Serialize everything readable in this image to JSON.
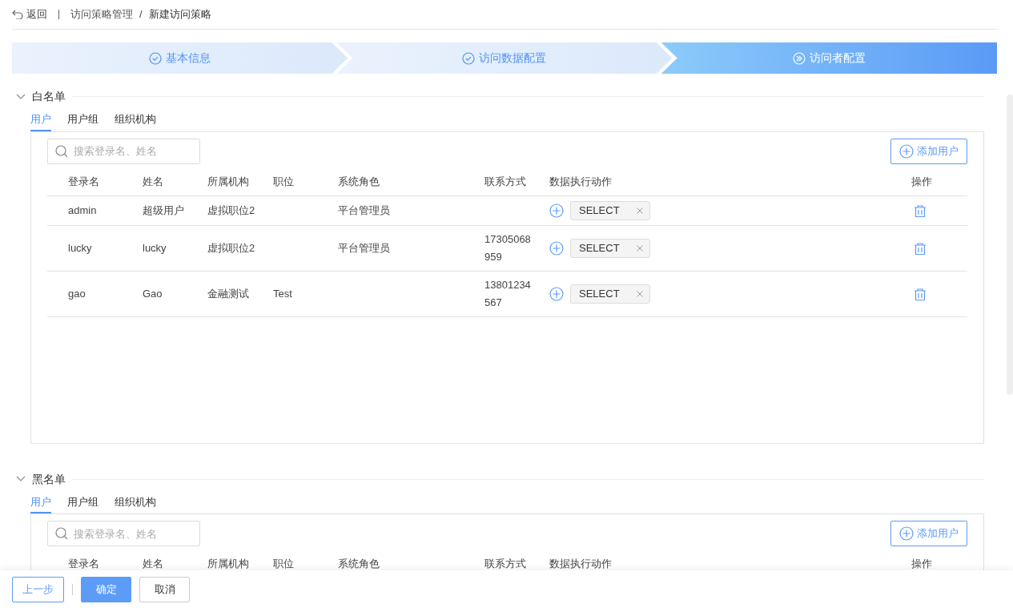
{
  "breadcrumb": {
    "back": "返回",
    "items": [
      "访问策略管理",
      "新建访问策略"
    ],
    "separator": "/"
  },
  "steps": [
    {
      "label": "基本信息",
      "selected": false
    },
    {
      "label": "访问数据配置",
      "selected": false
    },
    {
      "label": "访问者配置",
      "selected": true
    }
  ],
  "sections": [
    {
      "title": "白名单",
      "expanded": true,
      "tabs": [
        {
          "label": "用户",
          "selected": true
        },
        {
          "label": "用户组",
          "selected": false
        },
        {
          "label": "组织机构",
          "selected": false
        }
      ],
      "search": {
        "placeholder": "搜索登录名、姓名"
      },
      "add_button": "添加用户",
      "columns": [
        "登录名",
        "姓名",
        "所属机构",
        "职位",
        "系统角色",
        "联系方式",
        "数据执行动作",
        "操作"
      ],
      "rows": [
        {
          "login": "admin",
          "name": "超级用户",
          "org": "虚拟职位2",
          "role": "平台管理员",
          "actions": [
            "SELECT"
          ]
        },
        {
          "login": "lucky",
          "name": "lucky",
          "org": "虚拟职位2",
          "role": "平台管理员",
          "phone": "17305068959",
          "actions": [
            "SELECT"
          ]
        },
        {
          "login": "gao",
          "name": "Gao",
          "org": "金融测试",
          "position": "Test",
          "phone": "13801234567",
          "actions": [
            "SELECT"
          ]
        }
      ]
    },
    {
      "title": "黑名单",
      "expanded": true,
      "tabs": [
        {
          "label": "用户",
          "selected": true
        },
        {
          "label": "用户组",
          "selected": false
        },
        {
          "label": "组织机构",
          "selected": false
        }
      ],
      "search": {
        "placeholder": "搜索登录名、姓名"
      },
      "add_button": "添加用户",
      "columns": [
        "登录名",
        "姓名",
        "所属机构",
        "职位",
        "系统角色",
        "联系方式",
        "数据执行动作",
        "操作"
      ]
    }
  ],
  "footer": {
    "buttons": [
      {
        "label": "上一步",
        "kind": "outline"
      },
      {
        "label": "确定",
        "kind": "primary"
      },
      {
        "label": "取消",
        "kind": "default"
      }
    ]
  }
}
